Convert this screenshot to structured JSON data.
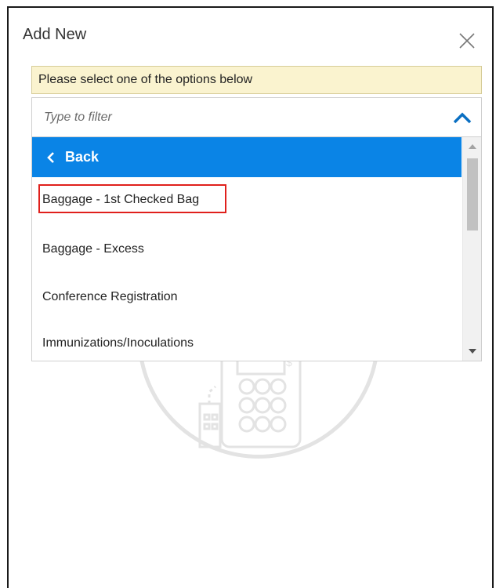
{
  "dialog": {
    "title": "Add New",
    "close_icon": "close-icon"
  },
  "notice": {
    "text": "Please select one of the options below"
  },
  "filter": {
    "placeholder": "Type to filter",
    "value": "",
    "toggle_icon": "chevron-up-icon"
  },
  "list": {
    "back_label": "Back",
    "back_icon": "chevron-left-icon",
    "items": [
      {
        "label": "Baggage - 1st Checked Bag",
        "highlighted": true
      },
      {
        "label": "Baggage - Excess",
        "highlighted": false
      },
      {
        "label": "Conference Registration",
        "highlighted": false
      },
      {
        "label": "Immunizations/Inoculations",
        "highlighted": false
      }
    ]
  },
  "colors": {
    "accent": "#0a84e6",
    "notice_bg": "#faf3cf",
    "highlight_border": "#e0201c",
    "illustration": "#e5e5e5"
  },
  "background_illustration": {
    "icon": "calculator-receipt-icon"
  }
}
